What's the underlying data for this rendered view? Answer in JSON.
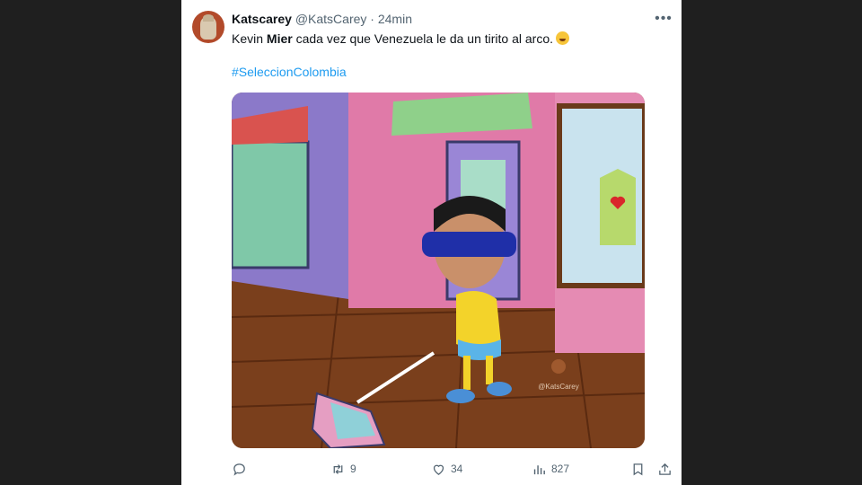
{
  "post": {
    "author_name": "Katscarey",
    "handle": "@KatsCarey",
    "separator": "·",
    "time": "24min",
    "text_part1": "Kevin ",
    "text_bold": "Mier",
    "text_part2": " cada vez que Venezuela le da un tirito al arco.",
    "emoji": "rolling-on-floor-laughing-emoji",
    "hashtag": "#SeleccionColombia",
    "media": {
      "description_icon": "meme-image",
      "watermark": "@KatsCarey"
    },
    "more_icon": "more-dots-icon"
  },
  "actions": {
    "reply": {
      "icon": "reply-icon",
      "count": ""
    },
    "repost": {
      "icon": "repost-icon",
      "count": "9"
    },
    "like": {
      "icon": "heart-icon",
      "count": "34"
    },
    "views": {
      "icon": "views-icon",
      "count": "827"
    },
    "bookmark": {
      "icon": "bookmark-icon"
    },
    "share": {
      "icon": "share-icon"
    }
  },
  "colors": {
    "link": "#1d9bf0",
    "secondary_text": "#536471",
    "primary_text": "#0f1419",
    "background": "#1f1f1f"
  }
}
